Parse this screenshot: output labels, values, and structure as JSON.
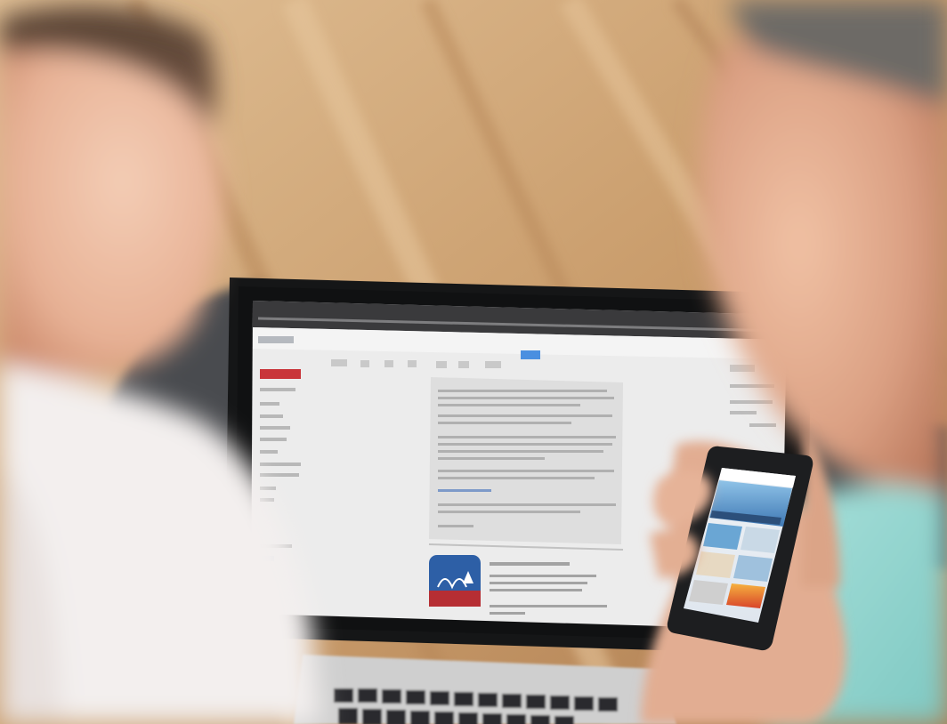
{
  "colors": {
    "floor_light": "#d9b588",
    "floor_mid": "#c89a69",
    "floor_dark": "#a9794d",
    "skin_light": "#f0c6ab",
    "skin_mid": "#d89b7c",
    "skin_dark": "#b8745b",
    "shirt_white": "#f2efee",
    "shirt_teal": "#8fd3ce",
    "laptop_bezel": "#171819",
    "screen_bg": "#eeeeee",
    "browser_bar": "#3b3b3d",
    "app_red": "#b52b2f",
    "app_blue": "#2c5fa9",
    "blanket": "#4c4e51",
    "phone_body": "#1e1f21"
  },
  "icons": {
    "laptop": "laptop-icon",
    "phone": "smartphone-icon",
    "app": "app-tile-icon"
  }
}
